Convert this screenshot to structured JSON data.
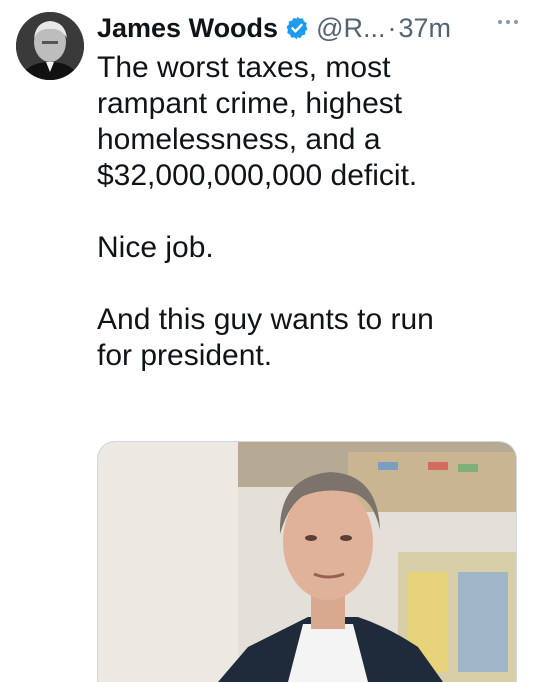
{
  "tweet": {
    "display_name": "James Woods",
    "handle": "@R...",
    "separator": "·",
    "timestamp": "37m",
    "text": {
      "p1_l1": "The worst taxes, most",
      "p1_l2": "rampant crime, highest",
      "p1_l3": "homelessness, and a",
      "p1_l4": "$32,000,000,000 deficit.",
      "p2": "Nice job.",
      "p3_l1": "And this guy wants to run",
      "p3_l2": "for president."
    },
    "icons": {
      "verified": "verified-badge-icon",
      "more": "more-options-icon"
    }
  },
  "colors": {
    "text_primary": "#0f1419",
    "text_secondary": "#536471",
    "verified_blue": "#1d9bf0",
    "card_border": "#cfd9de"
  }
}
